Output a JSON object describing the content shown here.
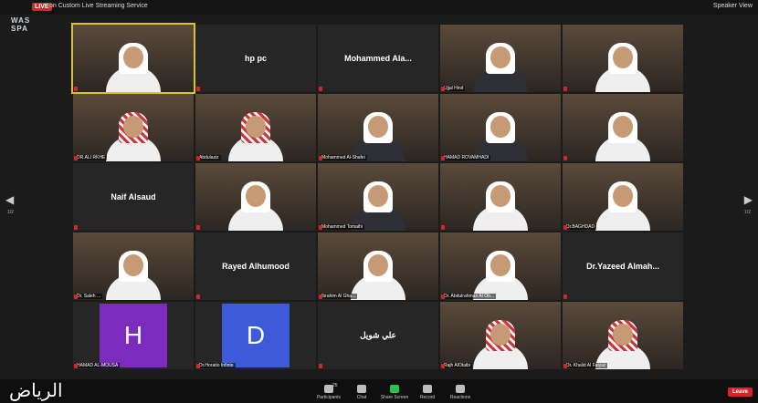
{
  "topbar": {
    "live": "LIVE",
    "stream": "on Custom Live Streaming Service",
    "speaker_view": "Speaker View"
  },
  "logo": {
    "line1": "WAS",
    "line2": "SPA"
  },
  "tiles": [
    {
      "row": 0,
      "col": 0,
      "kind": "video",
      "name": "",
      "style": "",
      "hl": true
    },
    {
      "row": 0,
      "col": 1,
      "kind": "label",
      "label": "hp pc"
    },
    {
      "row": 0,
      "col": 2,
      "kind": "label",
      "label": "Mohammed Ala..."
    },
    {
      "row": 0,
      "col": 3,
      "kind": "video",
      "name": "Ujjal Hind",
      "style": "dark"
    },
    {
      "row": 0,
      "col": 4,
      "kind": "video",
      "name": "",
      "style": ""
    },
    {
      "row": 1,
      "col": 0,
      "kind": "video",
      "name": "DR.ALI RKHE",
      "style": "red"
    },
    {
      "row": 1,
      "col": 1,
      "kind": "video",
      "name": "Abdulaziz",
      "style": "red"
    },
    {
      "row": 1,
      "col": 2,
      "kind": "video",
      "name": "Mohammed Al-Shafei",
      "style": "dark"
    },
    {
      "row": 1,
      "col": 3,
      "kind": "video",
      "name": "HAMAD ROVAMHADI",
      "style": "dark"
    },
    {
      "row": 1,
      "col": 4,
      "kind": "video",
      "name": "",
      "style": ""
    },
    {
      "row": 2,
      "col": 0,
      "kind": "label",
      "label": "Naif Alsaud"
    },
    {
      "row": 2,
      "col": 1,
      "kind": "video",
      "name": "",
      "style": ""
    },
    {
      "row": 2,
      "col": 2,
      "kind": "video",
      "name": "Mohammed Tomaihi",
      "style": "dark"
    },
    {
      "row": 2,
      "col": 3,
      "kind": "video",
      "name": "",
      "style": ""
    },
    {
      "row": 2,
      "col": 4,
      "kind": "video",
      "name": "Dr.BAGHDAD",
      "style": ""
    },
    {
      "row": 3,
      "col": 0,
      "kind": "video",
      "name": "Dr. Saleh ...",
      "style": ""
    },
    {
      "row": 3,
      "col": 1,
      "kind": "label",
      "label": "Rayed Alhumood"
    },
    {
      "row": 3,
      "col": 2,
      "kind": "video",
      "name": "Ibrahim Al Gha...",
      "style": ""
    },
    {
      "row": 3,
      "col": 3,
      "kind": "video",
      "name": "Dr. Abdulrahman Al Ob...",
      "style": ""
    },
    {
      "row": 3,
      "col": 4,
      "kind": "label",
      "label": "Dr.Yazeed Almah..."
    },
    {
      "row": 4,
      "col": 0,
      "kind": "avatar",
      "letter": "H",
      "color": "#7b2cbf",
      "name": "HAMAD AL-MOUSA"
    },
    {
      "row": 4,
      "col": 1,
      "kind": "avatar",
      "letter": "D",
      "color": "#3d5bd9",
      "name": "Dr.Horatio Infinte"
    },
    {
      "row": 4,
      "col": 2,
      "kind": "label",
      "label": "علي شويل"
    },
    {
      "row": 4,
      "col": 3,
      "kind": "video",
      "name": "Rajh AlOtaibi",
      "style": "red"
    },
    {
      "row": 4,
      "col": 4,
      "kind": "video",
      "name": "Dr. Khalid Al Faiyaz",
      "style": "red"
    }
  ],
  "nav": {
    "left": "◀",
    "right": "▶",
    "page_left": "1/2",
    "page_right": "1/2"
  },
  "bottombar": {
    "controls": [
      "Participants",
      "Chat",
      "Share Screen",
      "Record",
      "Reactions"
    ],
    "participants_count": "25",
    "leave": "Leave"
  },
  "watermark": "الرياض"
}
